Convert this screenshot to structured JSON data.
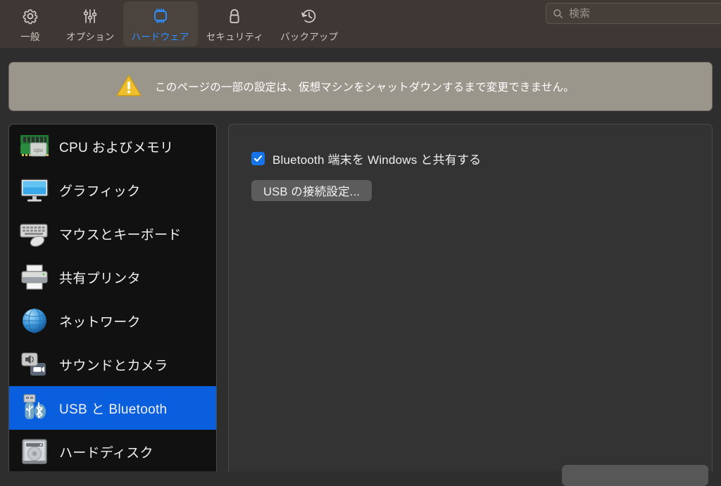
{
  "toolbar": {
    "tabs": [
      {
        "label": "一般",
        "icon": "gear-icon",
        "selected": false
      },
      {
        "label": "オプション",
        "icon": "sliders-icon",
        "selected": false
      },
      {
        "label": "ハードウェア",
        "icon": "cpu-chip-icon",
        "selected": true
      },
      {
        "label": "セキュリティ",
        "icon": "lock-icon",
        "selected": false
      },
      {
        "label": "バックアップ",
        "icon": "clock-rewind-icon",
        "selected": false
      }
    ],
    "accent_color": "#2f8eff",
    "background_color": "#3e3733"
  },
  "search": {
    "placeholder": "検索",
    "value": "",
    "icon": "search-icon"
  },
  "banner": {
    "icon": "warning-triangle-icon",
    "text": "このページの一部の設定は、仮想マシンをシャットダウンするまで変更できません。",
    "background_color": "#9a968c",
    "icon_color": "#f2c230"
  },
  "sidebar": {
    "selected_color": "#0a5fde",
    "items": [
      {
        "label": "CPU およびメモリ",
        "icon": "cpu-memory-icon",
        "selected": false
      },
      {
        "label": "グラフィック",
        "icon": "display-monitor-icon",
        "selected": false
      },
      {
        "label": "マウスとキーボード",
        "icon": "mouse-keyboard-icon",
        "selected": false
      },
      {
        "label": "共有プリンタ",
        "icon": "printer-icon",
        "selected": false
      },
      {
        "label": "ネットワーク",
        "icon": "globe-network-icon",
        "selected": false
      },
      {
        "label": "サウンドとカメラ",
        "icon": "speaker-camera-icon",
        "selected": false
      },
      {
        "label": "USB と Bluetooth",
        "icon": "usb-bluetooth-icon",
        "selected": true
      },
      {
        "label": "ハードディスク",
        "icon": "hard-disk-icon",
        "selected": false
      }
    ]
  },
  "content": {
    "share_bluetooth_checkbox": {
      "label": "Bluetooth 端末を Windows と共有する",
      "checked": true,
      "color": "#1673e8"
    },
    "usb_settings_button": "USB の接続設定...",
    "bottom_button": ""
  }
}
